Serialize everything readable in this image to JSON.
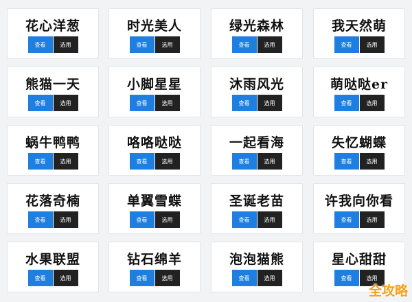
{
  "buttons": {
    "view_label": "查看",
    "select_label": "选用"
  },
  "fonts": [
    [
      "花心洋葱",
      "时光美人",
      "绿光森林",
      "我天然萌"
    ],
    [
      "熊猫一天",
      "小脚星星",
      "沐雨风光",
      "萌哒哒er"
    ],
    [
      "蜗牛鸭鸭",
      "咯咯哒哒",
      "一起看海",
      "失忆蝴蝶"
    ],
    [
      "花落奇楠",
      "单翼雪蝶",
      "圣诞老苗",
      "许我向你看"
    ],
    [
      "水果联盟",
      "钻石绵羊",
      "泡泡猫熊",
      "星心甜甜"
    ]
  ],
  "watermark": {
    "text": "全攻略",
    "color": "#f3a21a"
  }
}
